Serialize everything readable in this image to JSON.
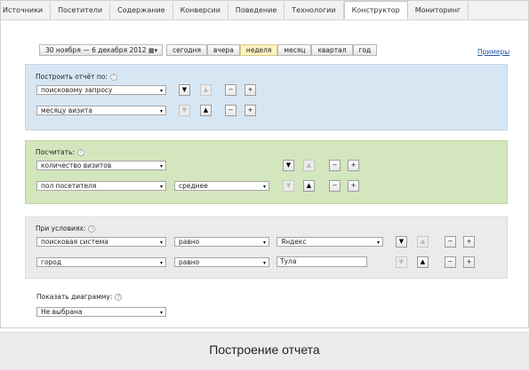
{
  "nav": {
    "tabs": [
      {
        "label": "Источники"
      },
      {
        "label": "Посетители"
      },
      {
        "label": "Содержание"
      },
      {
        "label": "Конверсии"
      },
      {
        "label": "Поведение"
      },
      {
        "label": "Технологии"
      },
      {
        "label": "Конструктор"
      },
      {
        "label": "Мониторинг"
      }
    ],
    "active_tab": "Конструктор"
  },
  "period": {
    "range": "30 ноября — 6 декабря 2012",
    "buttons": [
      "сегодня",
      "вчера",
      "неделя",
      "месяц",
      "квартал",
      "год"
    ],
    "selected": "неделя"
  },
  "examples_link": "Примеры",
  "build": {
    "label": "Построить отчёт по:",
    "rows": [
      {
        "value": "поисковому запросу"
      },
      {
        "value": "месяцу визита"
      }
    ]
  },
  "count": {
    "label": "Посчитать:",
    "rows": [
      {
        "value": "количество визитов"
      },
      {
        "value": "пол посетителя",
        "agg": "среднее"
      }
    ]
  },
  "conditions": {
    "label": "При условиях:",
    "rows": [
      {
        "field": "поисковая система",
        "op": "равно",
        "value": "Яндекс"
      },
      {
        "field": "город",
        "op": "равно",
        "value": "Тула"
      }
    ]
  },
  "diagram": {
    "label": "Показать диаграмму:",
    "value": "Не выбрана"
  },
  "caption": "Построение отчета",
  "glyphs": {
    "down": "▼",
    "up": "▲",
    "minus": "−",
    "plus": "+",
    "help": "?",
    "arrow": "▾",
    "cal": "▦▾"
  },
  "colors": {
    "blue_panel": "#d7e6f3",
    "green_panel": "#d3e6bd",
    "gray_panel": "#ebebeb",
    "active_period": "#fff3c2"
  }
}
